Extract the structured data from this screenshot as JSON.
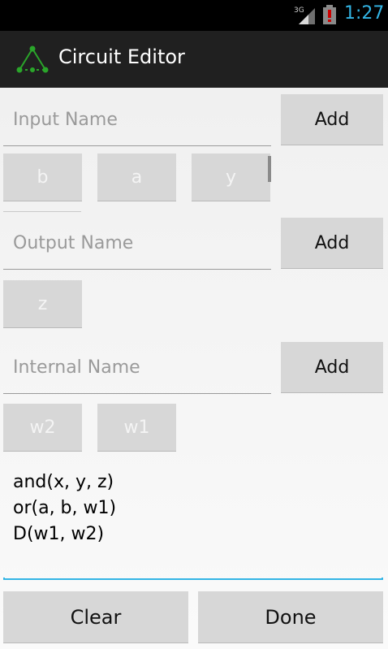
{
  "status_bar": {
    "network": "3G",
    "time": "1:27",
    "icons": [
      "signal-icon",
      "battery-alert-icon"
    ],
    "colors": {
      "time": "#33b5e5",
      "battery_alert": "#cc0000"
    }
  },
  "action_bar": {
    "title": "Circuit Editor",
    "icon": "circuit-triangle-icon",
    "colors": {
      "background": "#202020",
      "icon": "#2aa52a"
    }
  },
  "inputs_section": {
    "placeholder": "Input Name",
    "value": "",
    "add_label": "Add",
    "items": [
      "b",
      "a",
      "y"
    ]
  },
  "outputs_section": {
    "placeholder": "Output Name",
    "value": "",
    "add_label": "Add",
    "items": [
      "z"
    ]
  },
  "internals_section": {
    "placeholder": "Internal Name",
    "value": "",
    "add_label": "Add",
    "items": [
      "w2",
      "w1"
    ]
  },
  "editor": {
    "lines": [
      "and(x, y, z)",
      "or(a, b, w1)",
      "D(w1, w2)"
    ],
    "colors": {
      "focus_underline": "#33b5e5"
    }
  },
  "footer": {
    "clear_label": "Clear",
    "done_label": "Done"
  }
}
